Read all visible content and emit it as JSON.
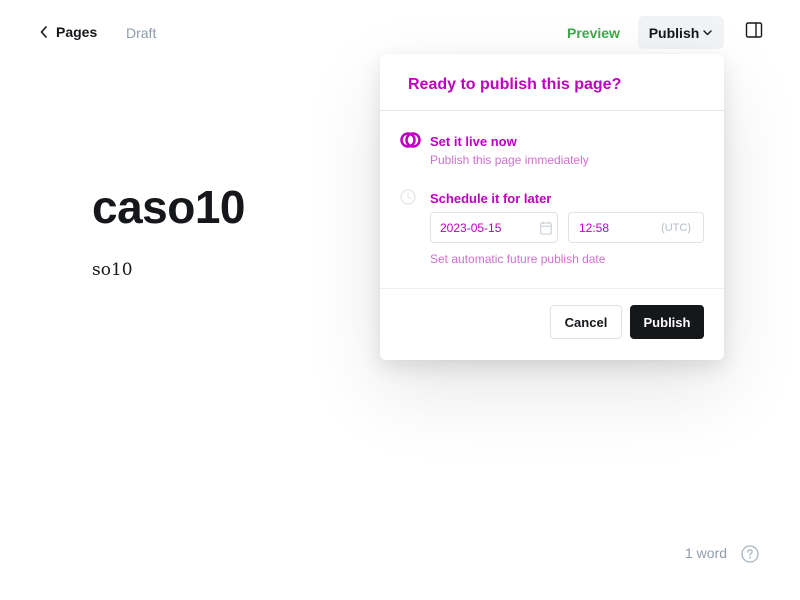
{
  "header": {
    "back_label": "Pages",
    "status": "Draft",
    "preview_label": "Preview",
    "publish_menu_label": "Publish"
  },
  "post": {
    "title": "caso10",
    "body": "so10",
    "word_count": "1 word"
  },
  "publish_popover": {
    "title": "Ready to publish this page?",
    "options": [
      {
        "title": "Set it live now",
        "description": "Publish this page immediately",
        "selected": true
      },
      {
        "title": "Schedule it for later",
        "description": "",
        "selected": false
      }
    ],
    "date_value": "2023-05-15",
    "time_value": "12:58",
    "timezone": "(UTC)",
    "schedule_hint": "Set automatic future publish date",
    "cancel_label": "Cancel",
    "publish_label": "Publish"
  },
  "colors": {
    "accent_green": "#3bab48",
    "text_dark": "#15171a",
    "muted": "#8e9cac",
    "overlay_magenta": "#c000c0"
  },
  "icons": {
    "back": "chevron-left-icon",
    "publish_menu": "chevron-down-icon",
    "sidebar": "sidebar-toggle-icon",
    "calendar": "calendar-icon",
    "help": "question-circle-icon"
  }
}
